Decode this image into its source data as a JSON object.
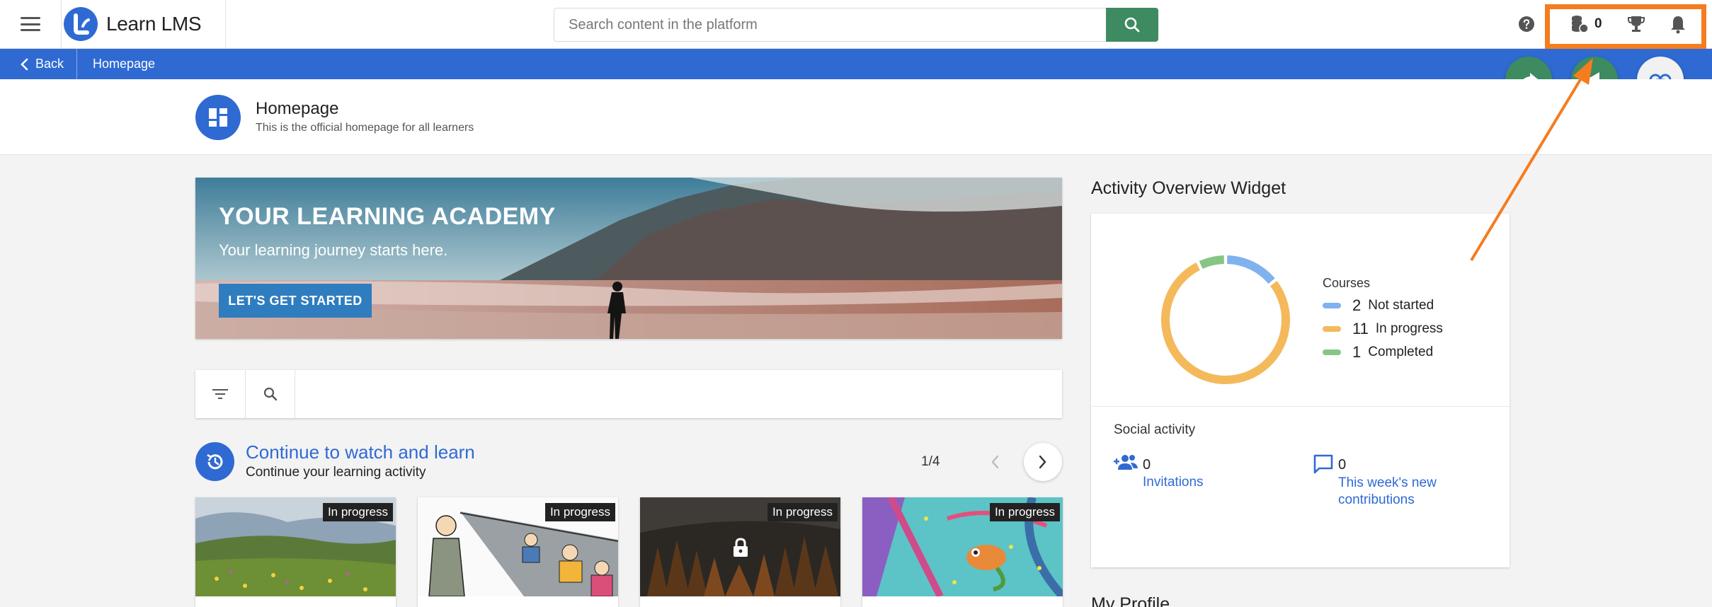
{
  "header": {
    "brand": "Learn LMS",
    "search_placeholder": "Search content in the platform",
    "coins_count": "0",
    "icons": [
      "menu-icon",
      "search-icon",
      "help-icon",
      "coins-icon",
      "trophy-icon",
      "bell-icon"
    ]
  },
  "breadcrumb": {
    "back_label": "Back",
    "current": "Homepage"
  },
  "page": {
    "title": "Homepage",
    "subtitle": "This is the official homepage for all learners"
  },
  "hero": {
    "title": "YOUR LEARNING ACADEMY",
    "subtitle": "Your learning journey starts here.",
    "button": "LET'S GET STARTED"
  },
  "continue": {
    "title": "Continue to watch and learn",
    "subtitle": "Continue your learning activity",
    "pager": "1/4",
    "cards": [
      {
        "badge": "In progress"
      },
      {
        "badge": "In progress"
      },
      {
        "badge": "In progress"
      },
      {
        "badge": "In progress"
      }
    ]
  },
  "activity": {
    "title": "Activity Overview Widget",
    "courses_label": "Courses",
    "legend": [
      {
        "count": "2",
        "label": "Not started",
        "color": "#7fb2ee"
      },
      {
        "count": "11",
        "label": "In progress",
        "color": "#f4b95b"
      },
      {
        "count": "1",
        "label": "Completed",
        "color": "#86c684"
      }
    ],
    "social_label": "Social activity",
    "invitations_count": "0",
    "invitations_label": "Invitations",
    "contributions_count": "0",
    "contributions_label": "This week's new contributions"
  },
  "my_profile": "My Profile",
  "colors": {
    "primary": "#2f6ad3",
    "accent_green": "#3e8a61",
    "highlight_orange": "#f57c1f"
  }
}
